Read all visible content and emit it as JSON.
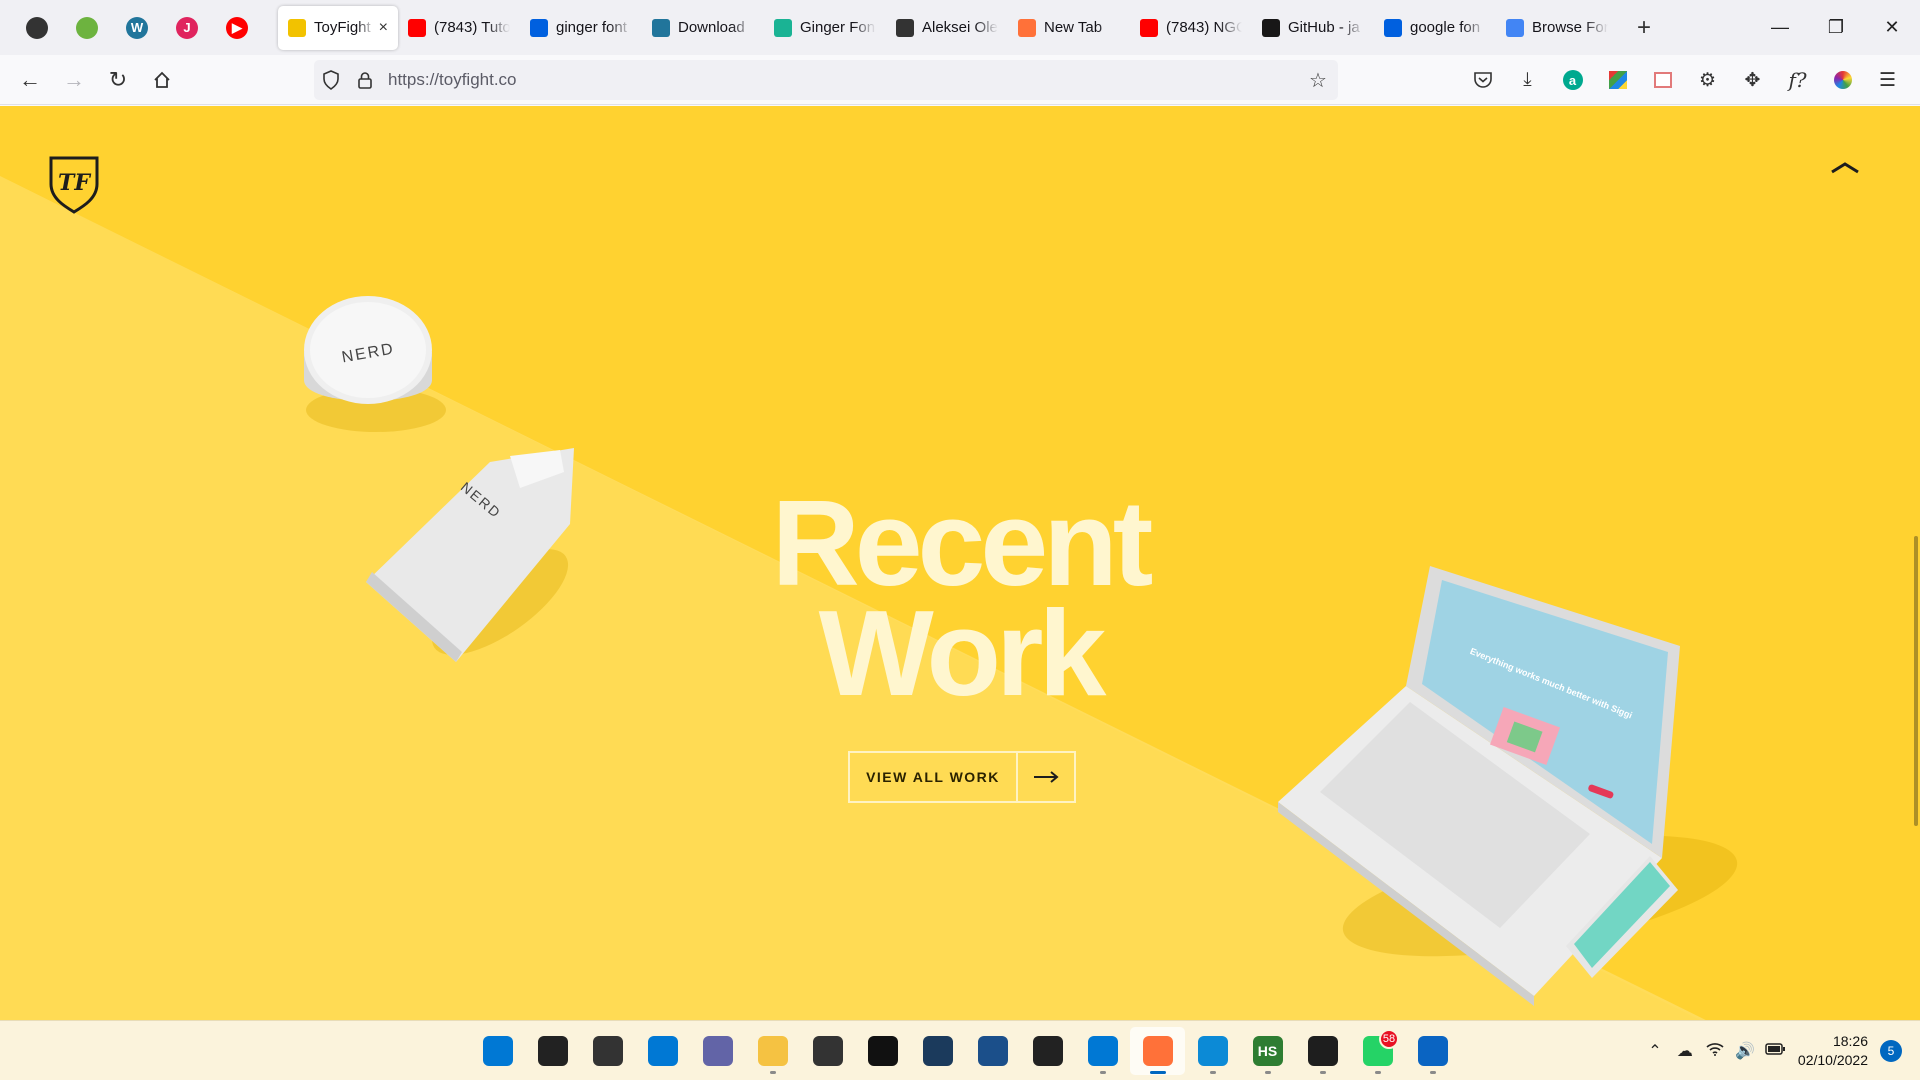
{
  "browser": {
    "pinned_tabs": [
      {
        "icon": "globe-icon",
        "label": "",
        "color": "#333333"
      },
      {
        "icon": "leaf-icon",
        "label": "",
        "color": "#6db33f"
      },
      {
        "icon": "wordpress-icon",
        "label": "W",
        "color": "#21759b"
      },
      {
        "icon": "j-icon",
        "label": "J",
        "color": "#e0245e"
      },
      {
        "icon": "youtube-icon",
        "label": "▶",
        "color": "#ff0000"
      }
    ],
    "tabs": [
      {
        "title": "ToyFight",
        "icon": "toyfight-icon",
        "color": "#f2c200",
        "active": true
      },
      {
        "title": "(7843) Tuto",
        "icon": "youtube-icon",
        "color": "#ff0000",
        "active": false
      },
      {
        "title": "ginger font",
        "icon": "search-icon",
        "color": "#0060df",
        "active": false
      },
      {
        "title": "Download",
        "icon": "wordpress-icon",
        "color": "#21759b",
        "active": false
      },
      {
        "title": "Ginger Fon",
        "icon": "ginger-icon",
        "color": "#1ab394",
        "active": false
      },
      {
        "title": "Aleksei Ole",
        "icon": "wikipedia-icon",
        "color": "#333333",
        "active": false
      },
      {
        "title": "New Tab",
        "icon": "firefox-icon",
        "color": "#ff7139",
        "active": false
      },
      {
        "title": "(7843) NGC",
        "icon": "youtube-icon",
        "color": "#ff0000",
        "active": false
      },
      {
        "title": "GitHub - ja",
        "icon": "github-icon",
        "color": "#181717",
        "active": false
      },
      {
        "title": "google fon",
        "icon": "search-icon",
        "color": "#0060df",
        "active": false
      },
      {
        "title": "Browse For",
        "icon": "google-fonts-icon",
        "color": "#4285f4",
        "active": false
      }
    ],
    "new_tab": "+",
    "url": "https://toyfight.co"
  },
  "page": {
    "headline_line1": "Recent",
    "headline_line2": "Work",
    "cta_label": "VIEW ALL WORK",
    "jar_brand": "NERD",
    "tube_brand": "NERD",
    "laptop_screen_text": "Everything works much better with Siggi",
    "colors": {
      "background": "#ffd230",
      "headline": "#fff6cf"
    }
  },
  "taskbar": {
    "apps": [
      {
        "name": "start-icon",
        "glyph": "",
        "color": "#0078d4",
        "running": false
      },
      {
        "name": "search-icon",
        "glyph": "",
        "color": "#222222",
        "running": false
      },
      {
        "name": "task-view-icon",
        "glyph": "",
        "color": "#333333",
        "running": false
      },
      {
        "name": "widgets-icon",
        "glyph": "",
        "color": "#0078d4",
        "running": false
      },
      {
        "name": "teams-chat-icon",
        "glyph": "",
        "color": "#6264a7",
        "running": false
      },
      {
        "name": "file-explorer-icon",
        "glyph": "",
        "color": "#f5c242",
        "running": true
      },
      {
        "name": "store-icon",
        "glyph": "",
        "color": "#333333",
        "running": false
      },
      {
        "name": "dropbox-icon",
        "glyph": "",
        "color": "#111111",
        "running": false
      },
      {
        "name": "cube-app-icon",
        "glyph": "",
        "color": "#1b3a5c",
        "running": false
      },
      {
        "name": "photo-app-icon",
        "glyph": "",
        "color": "#1b4f8a",
        "running": false
      },
      {
        "name": "sticky-notes-icon",
        "glyph": "",
        "color": "#222222",
        "running": false
      },
      {
        "name": "vscode-icon",
        "glyph": "",
        "color": "#0078d4",
        "running": true
      },
      {
        "name": "firefox-icon",
        "glyph": "",
        "color": "#ff7139",
        "running": true,
        "active": true
      },
      {
        "name": "edge-icon",
        "glyph": "",
        "color": "#0c8ad6",
        "running": true
      },
      {
        "name": "hubspot-icon",
        "glyph": "HS",
        "color": "#2e7d32",
        "running": true
      },
      {
        "name": "figma-icon",
        "glyph": "",
        "color": "#1e1e1e",
        "running": true
      },
      {
        "name": "whatsapp-icon",
        "glyph": "",
        "color": "#25d366",
        "running": true,
        "badge": "58"
      },
      {
        "name": "media-app-icon",
        "glyph": "",
        "color": "#0a64c2",
        "running": true
      }
    ],
    "time": "18:26",
    "date": "02/10/2022",
    "notifications": "5"
  }
}
